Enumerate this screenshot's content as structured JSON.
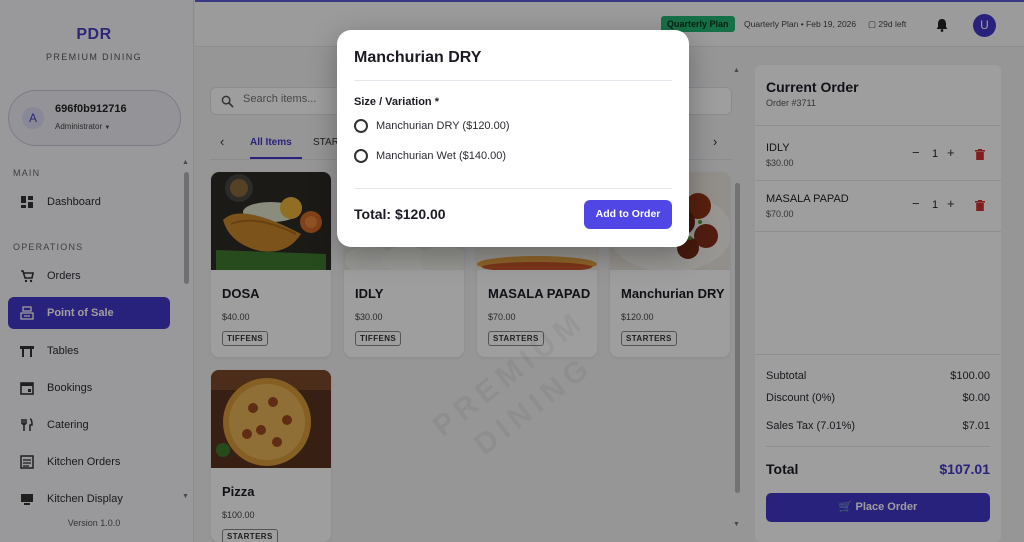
{
  "brand": {
    "title": "PDR",
    "subtitle": "PREMIUM DINING"
  },
  "user": {
    "initial": "A",
    "name": "696f0b912716",
    "role": "Administrator"
  },
  "sidebar": {
    "sections": {
      "main": "MAIN",
      "operations": "OPERATIONS"
    },
    "items": [
      {
        "label": "Dashboard",
        "icon": "dashboard-icon"
      },
      {
        "label": "Orders",
        "icon": "cart-icon"
      },
      {
        "label": "Point of Sale",
        "icon": "register-icon",
        "active": true
      },
      {
        "label": "Tables",
        "icon": "table-icon"
      },
      {
        "label": "Bookings",
        "icon": "calendar-icon"
      },
      {
        "label": "Catering",
        "icon": "utensils-icon"
      },
      {
        "label": "Kitchen Orders",
        "icon": "list-icon"
      },
      {
        "label": "Kitchen Display",
        "icon": "monitor-icon"
      }
    ],
    "version": "Version 1.0.0"
  },
  "topbar": {
    "plan_badge": "Quarterly Plan",
    "plan_info": "Quarterly Plan • Feb 19, 2026",
    "days_left": "29d left",
    "avatar_initial": "U"
  },
  "search": {
    "placeholder": "Search items..."
  },
  "tabs": [
    {
      "label": "All Items",
      "active": true
    },
    {
      "label": "STARTERS"
    }
  ],
  "menu_items": [
    {
      "name": "DOSA",
      "price": "$40.00",
      "category": "TIFFENS"
    },
    {
      "name": "IDLY",
      "price": "$30.00",
      "category": "TIFFENS"
    },
    {
      "name": "MASALA PAPAD",
      "price": "$70.00",
      "category": "STARTERS"
    },
    {
      "name": "Manchurian DRY",
      "price": "$120.00",
      "category": "STARTERS"
    },
    {
      "name": "Pizza",
      "price": "$100.00",
      "category": "STARTERS"
    }
  ],
  "watermark": {
    "line1": "PREMIUM",
    "line2": "DINING"
  },
  "order": {
    "title": "Current Order",
    "number": "Order #3711",
    "items": [
      {
        "name": "IDLY",
        "price": "$30.00",
        "qty": "1"
      },
      {
        "name": "MASALA PAPAD",
        "price": "$70.00",
        "qty": "1"
      }
    ],
    "subtotal_label": "Subtotal",
    "subtotal": "$100.00",
    "discount_label": "Discount (0%)",
    "discount": "$0.00",
    "tax_label": "Sales Tax (7.01%)",
    "tax": "$7.01",
    "total_label": "Total",
    "total": "$107.01",
    "place_label": "Place Order"
  },
  "modal": {
    "title": "Manchurian DRY",
    "variation_label": "Size / Variation *",
    "options": [
      {
        "label": "Manchurian DRY ($120.00)"
      },
      {
        "label": "Manchurian Wet ($140.00)"
      }
    ],
    "total": "Total: $120.00",
    "add_label": "Add to Order"
  },
  "colors": {
    "accent": "#4338ca",
    "plan_badge": "#22b573",
    "delete": "#d32f2f"
  }
}
